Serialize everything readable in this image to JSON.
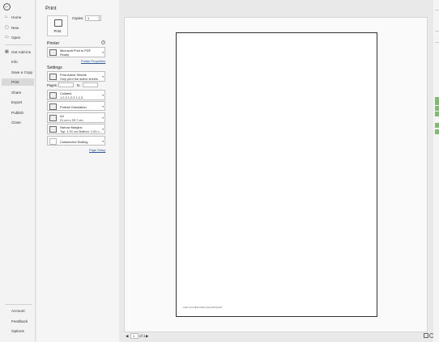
{
  "nav": {
    "back_icon": "back-arrow-icon",
    "items": [
      {
        "label": "Home",
        "icon": "home-icon",
        "glyph": "⌂"
      },
      {
        "label": "New",
        "icon": "new-document-icon",
        "glyph": "▢"
      },
      {
        "label": "Open",
        "icon": "folder-open-icon",
        "glyph": "▭"
      },
      {
        "label": "Get Add-ins",
        "icon": "add-in-icon",
        "glyph": "▦"
      },
      {
        "label": "Info"
      },
      {
        "label": "Save a Copy"
      },
      {
        "label": "Print",
        "active": true
      },
      {
        "label": "Share"
      },
      {
        "label": "Export"
      },
      {
        "label": "Publish"
      },
      {
        "label": "Close"
      }
    ],
    "bottom_items": [
      {
        "label": "Account"
      },
      {
        "label": "Feedback"
      },
      {
        "label": "Options"
      }
    ]
  },
  "print": {
    "title": "Print",
    "button_label": "Print",
    "copies_label": "Copies:",
    "copies_value": "1"
  },
  "printer": {
    "section_title": "Printer",
    "name": "Microsoft Print to PDF",
    "status": "Ready",
    "properties_link": "Printer Properties"
  },
  "settings": {
    "section_title": "Settings",
    "what": {
      "line1": "Print Active Sheets",
      "line2": "Only print the active sheets"
    },
    "pages_label": "Pages:",
    "to_label": "to",
    "collate": {
      "line1": "Collated",
      "line2": "1,2,3    1,2,3    1,2,3"
    },
    "orientation": {
      "line1": "Portrait Orientation"
    },
    "paper": {
      "line1": "A4",
      "line2": "21 cm x 29.7 cm"
    },
    "margins": {
      "line1": "Narrow Margins",
      "line2": "Top: 1.91 cm Bottom: 1.91 c..."
    },
    "scaling": {
      "line1": "Customized Scaling"
    },
    "page_setup_link": "Page Setup"
  },
  "preview": {
    "footer_text": "Learn more about chart types and layouts",
    "page_number": "1",
    "of_label": "of 1"
  },
  "colors": {
    "link": "#2b5797",
    "sidebar_bg": "#f3f3f3",
    "active_nav": "#d9d9d9"
  }
}
